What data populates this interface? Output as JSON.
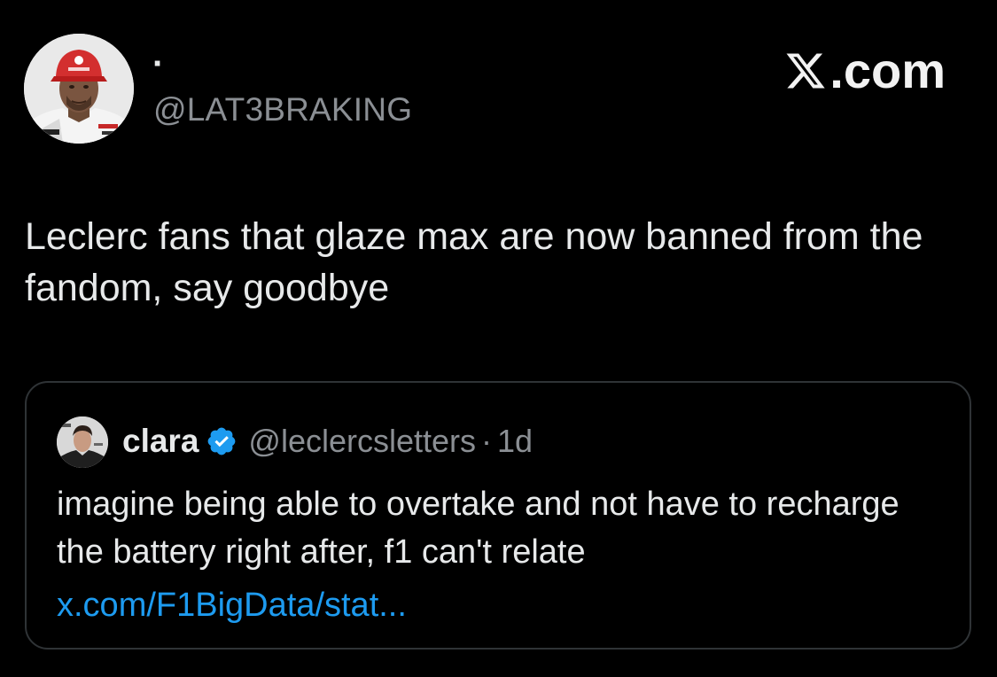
{
  "tweet": {
    "display_name": "·",
    "handle": "@LAT3BRAKING",
    "brand": ".com",
    "text": "Leclerc fans that glaze max are now banned from the fandom, say goodbye",
    "avatar_icon": "driver-portrait-icon"
  },
  "quote": {
    "name": "clara",
    "handle": "@leclercsletters",
    "separator": "·",
    "time": "1d",
    "text": "imagine being able to overtake and not have to recharge the battery right after, f1 can't relate",
    "link": "x.com/F1BigData/stat...",
    "avatar_icon": "driver-portrait-icon",
    "verified_icon": "verified-badge-icon"
  },
  "colors": {
    "background": "#000000",
    "text": "#e7e9ea",
    "secondary": "#8b8f94",
    "link": "#1d9bf0",
    "border": "#2f3336",
    "verified": "#1d9bf0"
  }
}
